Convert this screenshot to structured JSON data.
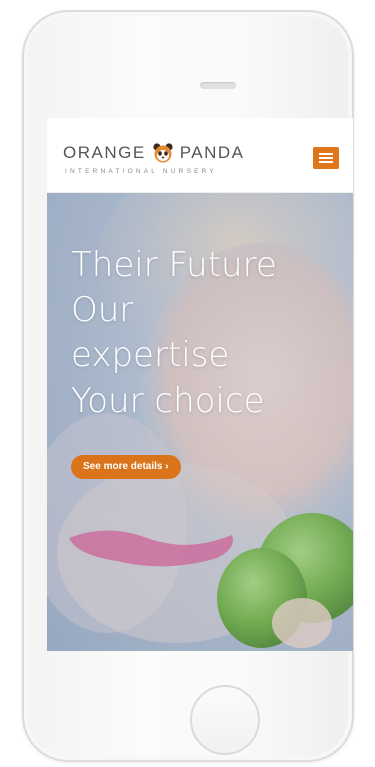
{
  "header": {
    "logo_left": "ORANGE",
    "logo_right": "PANDA",
    "logo_tagline": "INTERNATIONAL NURSERY",
    "menu_icon": "hamburger-menu-icon"
  },
  "hero": {
    "headline_lines": [
      "Their Future",
      "Our",
      "expertise",
      "Your choice"
    ],
    "cta_label": "See more details ›"
  },
  "colors": {
    "accent": "#e0761c",
    "cta": "#d9741a",
    "logo_text": "#555555",
    "hero_text": "#ffffff"
  }
}
